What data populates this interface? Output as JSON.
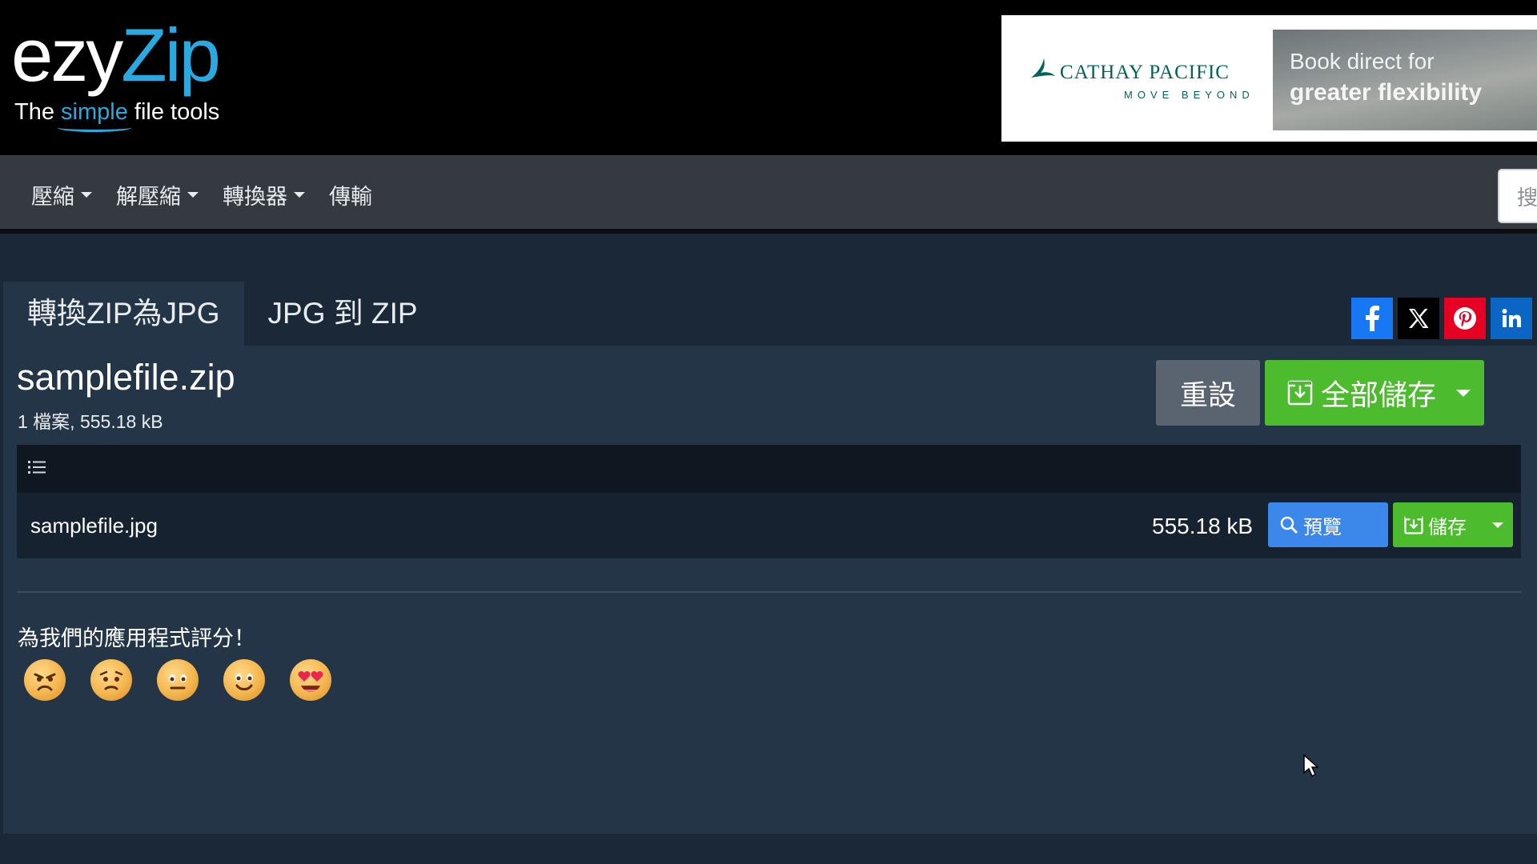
{
  "logo": {
    "ezy": "ezy",
    "zip": "Zip",
    "tagline_pre": "The ",
    "tagline_simple": "simple",
    "tagline_post": " file tools"
  },
  "ad": {
    "brand": "CATHAY PACIFIC",
    "brand_sub": "MOVE BEYOND",
    "line1": "Book direct for",
    "line2": "greater flexibility"
  },
  "nav": {
    "items": [
      {
        "label": "壓縮",
        "dropdown": true
      },
      {
        "label": "解壓縮",
        "dropdown": true
      },
      {
        "label": "轉換器",
        "dropdown": true
      },
      {
        "label": "傳輸",
        "dropdown": false
      }
    ],
    "search_placeholder": "搜"
  },
  "tabs": [
    {
      "label": "轉換ZIP為JPG",
      "active": true
    },
    {
      "label": "JPG 到 ZIP",
      "active": false
    }
  ],
  "social": [
    "facebook-icon",
    "x-icon",
    "pinterest-icon",
    "linkedin-icon"
  ],
  "archive": {
    "name": "samplefile.zip",
    "meta": "1 檔案, 555.18 kB"
  },
  "actions": {
    "reset": "重設",
    "save_all": "全部儲存"
  },
  "files": [
    {
      "name": "samplefile.jpg",
      "size": "555.18 kB",
      "preview": "預覽",
      "save": "儲存"
    }
  ],
  "rating": {
    "title": "為我們的應用程式評分！",
    "emojis": [
      "angry",
      "sad",
      "neutral",
      "smile",
      "love"
    ]
  },
  "colors": {
    "brand_blue": "#29a9e0",
    "save_green": "#4cbb2d",
    "preview_blue": "#3b87ea",
    "reset_gray": "#5a6470",
    "panel": "#253548",
    "nav": "#343a40"
  }
}
